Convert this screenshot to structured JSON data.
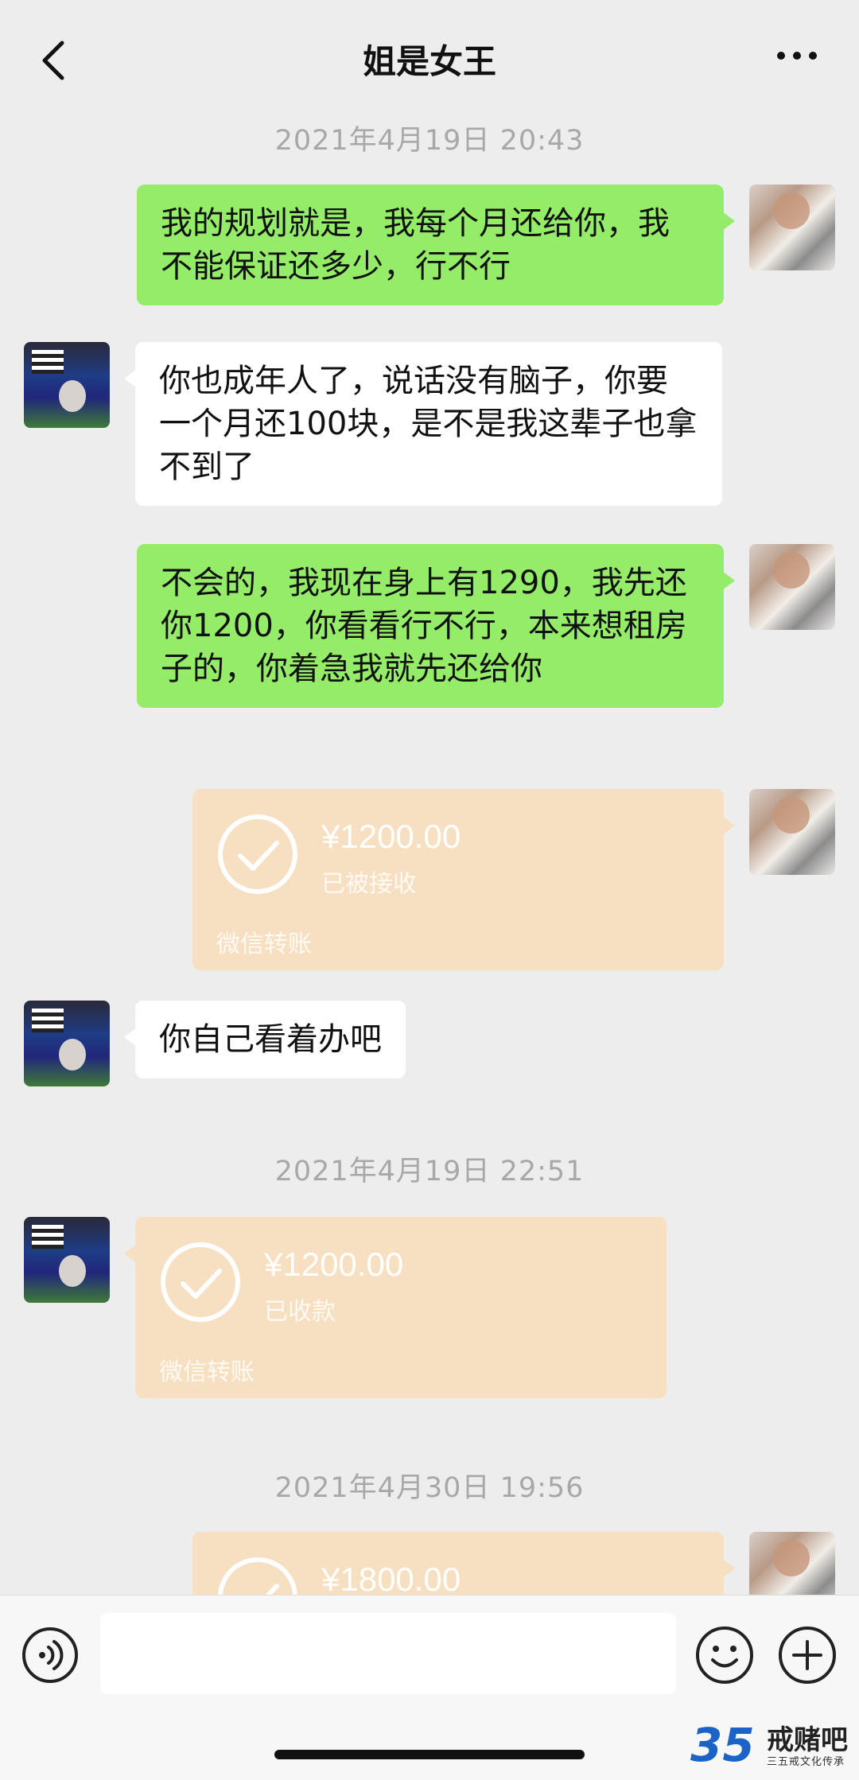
{
  "header": {
    "title": "姐是女王"
  },
  "messages": {
    "ts1": "2021年4月19日 20:43",
    "m1": "我的规划就是，我每个月还给你，我不能保证还多少，行不行",
    "m2": "你也成年人了，说话没有脑子，你要一个月还100块，是不是我这辈子也拿不到了",
    "m3": "不会的，我现在身上有1290，我先还你1200，你看看行不行，本来想租房子的，你着急我就先还给你",
    "transfer1": {
      "amount": "¥1200.00",
      "status": "已被接收",
      "label": "微信转账"
    },
    "m4": "你自己看着办吧",
    "ts2": "2021年4月19日 22:51",
    "transfer2": {
      "amount": "¥1200.00",
      "status": "已收款",
      "label": "微信转账"
    },
    "ts3": "2021年4月30日 19:56",
    "transfer3": {
      "amount": "¥1800.00"
    }
  },
  "watermark": {
    "number": "35",
    "name": "戒赌吧",
    "sub": "三五戒文化传承"
  },
  "icons": {
    "back": "chevron-left-icon",
    "more": "more-dots-icon",
    "voice": "voice-icon",
    "emoji": "emoji-icon",
    "plus": "plus-icon"
  },
  "colors": {
    "my_bubble": "#95ec69",
    "their_bubble": "#ffffff",
    "transfer": "#f7dfc1",
    "background": "#ededed"
  }
}
